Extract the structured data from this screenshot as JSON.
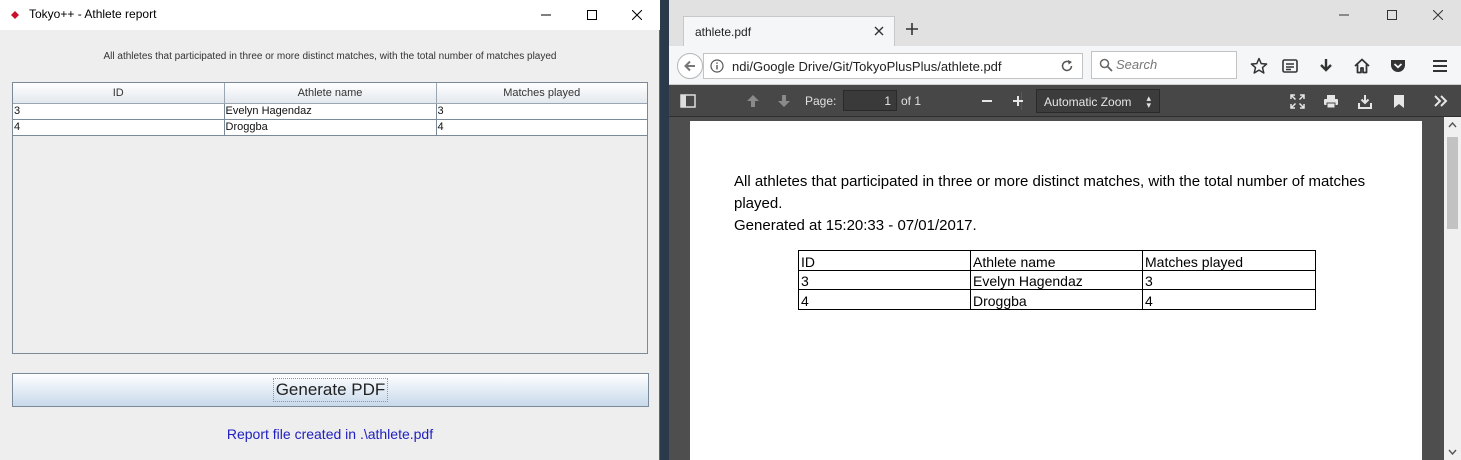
{
  "swing": {
    "title": "Tokyo++ - Athlete report",
    "description": "All athletes that participated in three or more distinct matches, with the total number of matches played",
    "table": {
      "headers": [
        "ID",
        "Athlete name",
        "Matches played"
      ],
      "rows": [
        [
          "3",
          "Evelyn Hagendaz",
          "3"
        ],
        [
          "4",
          "Droggba",
          "4"
        ]
      ]
    },
    "generate_label": "Generate PDF",
    "status": "Report file created in .\\athlete.pdf"
  },
  "firefox": {
    "tab_title": "athlete.pdf",
    "url": "ndi/Google Drive/Git/TokyoPlusPlus/athlete.pdf",
    "search_placeholder": "Search",
    "pdf_toolbar": {
      "page_label": "Page:",
      "page_value": "1",
      "page_of": "of 1",
      "zoom": "Automatic Zoom"
    },
    "pdf": {
      "line1": "All athletes that participated in three or more distinct matches, with the total number of matches played.",
      "line2": "Generated at 15:20:33 - 07/01/2017.",
      "table": {
        "headers": [
          "ID",
          "Athlete name",
          "Matches played"
        ],
        "rows": [
          [
            "3",
            "Evelyn Hagendaz",
            "3"
          ],
          [
            "4",
            "Droggba",
            "4"
          ]
        ]
      }
    }
  },
  "colors": {
    "swing_bg": "#eeeeee",
    "status_text": "#2020c0",
    "pdf_toolbar_bg": "#474747",
    "pdf_viewer_bg": "#4e4e4e"
  }
}
